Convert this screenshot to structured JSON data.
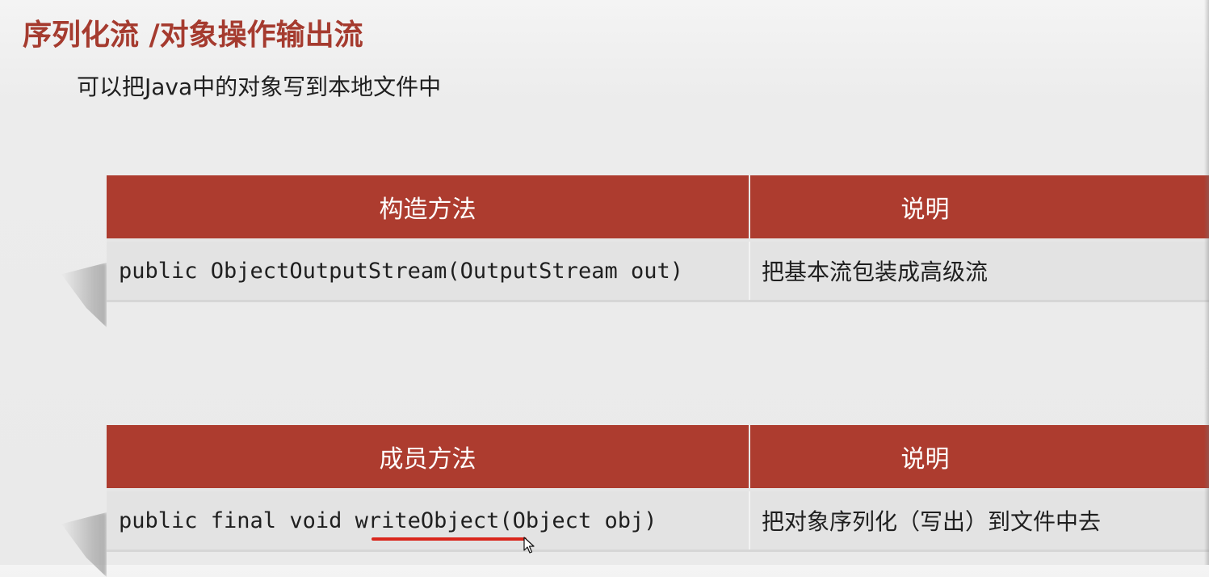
{
  "title": "序列化流 /对象操作输出流",
  "subtitle": "可以把Java中的对象写到本地文件中",
  "constructor_table": {
    "headers": [
      "构造方法",
      "说明"
    ],
    "rows": [
      {
        "signature": "public ObjectOutputStream(OutputStream out)",
        "description": "把基本流包装成高级流"
      }
    ]
  },
  "method_table": {
    "headers": [
      "成员方法",
      "说明"
    ],
    "rows": [
      {
        "signature": "public final void writeObject(Object obj)",
        "description": "把对象序列化（写出）到文件中去"
      }
    ]
  },
  "colors": {
    "title": "#a53b2f",
    "header_bg": "#ad3c2f",
    "underline": "#d9261c"
  },
  "icons": [
    "mouse-cursor-icon"
  ]
}
